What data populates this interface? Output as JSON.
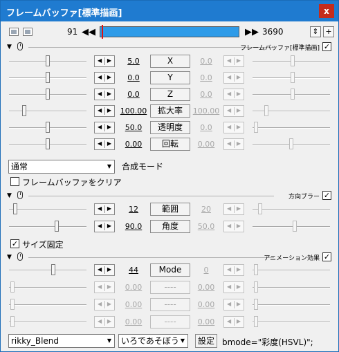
{
  "window": {
    "title": "フレームバッファ[標準描画]",
    "close_label": "x"
  },
  "timeline": {
    "start_frame": "91",
    "end_frame": "3690",
    "prev_label": "◀◀",
    "next_label": "▶▶",
    "position": 0.01,
    "extra_buttons": [
      "⇕",
      "+"
    ]
  },
  "sections": {
    "main": {
      "name": "フレームバッファ[標準描画]",
      "checked": "✓"
    },
    "blur": {
      "name": "方向ブラー",
      "checked": "✓"
    },
    "anim": {
      "name": "アニメーション効果",
      "checked": "✓"
    }
  },
  "main_rows": [
    {
      "label": "X",
      "start": "5.0",
      "end": "0.0",
      "left_pos": 0.5,
      "right_pos": 0.52
    },
    {
      "label": "Y",
      "start": "0.0",
      "end": "0.0",
      "left_pos": 0.5,
      "right_pos": 0.52
    },
    {
      "label": "Z",
      "start": "0.0",
      "end": "0.0",
      "left_pos": 0.5,
      "right_pos": 0.52
    },
    {
      "label": "拡大率",
      "start": "100.00",
      "end": "100.00",
      "left_pos": 0.18,
      "right_pos": 0.16
    },
    {
      "label": "透明度",
      "start": "50.0",
      "end": "0.0",
      "left_pos": 0.5,
      "right_pos": 0.02
    },
    {
      "label": "回転",
      "start": "0.00",
      "end": "0.00",
      "left_pos": 0.5,
      "right_pos": 0.5
    }
  ],
  "blend_mode": {
    "value": "通常",
    "label": "合成モード"
  },
  "clear_checkbox": {
    "label": "フレームバッファをクリア",
    "checked": ""
  },
  "blur_rows": [
    {
      "label": "範囲",
      "start": "12",
      "end": "20",
      "left_pos": 0.06,
      "right_pos": 0.08
    },
    {
      "label": "角度",
      "start": "90.0",
      "end": "50.0",
      "left_pos": 0.62,
      "right_pos": 0.55
    }
  ],
  "size_fixed": {
    "label": "サイズ固定",
    "checked": "✓"
  },
  "anim_rows": [
    {
      "label": "Mode",
      "start": "44",
      "end": "0",
      "left_pos": 0.58,
      "right_pos": 0.02,
      "disabled": false
    },
    {
      "label": "----",
      "start": "0.00",
      "end": "0.00",
      "left_pos": 0.02,
      "right_pos": 0.02,
      "disabled": true
    },
    {
      "label": "----",
      "start": "0.00",
      "end": "0.00",
      "left_pos": 0.02,
      "right_pos": 0.02,
      "disabled": true
    },
    {
      "label": "----",
      "start": "0.00",
      "end": "0.00",
      "left_pos": 0.02,
      "right_pos": 0.02,
      "disabled": true
    }
  ],
  "footer": {
    "script_select": "rikky_Blend",
    "pack_select": "いろであそぼう",
    "settings_button": "設定",
    "param_text": "bmode=\"彩度(HSVL)\";"
  },
  "icons": {
    "arrow_left": "◀",
    "arrow_right": "▶",
    "dropdown": "▼",
    "collapse": "▼"
  }
}
